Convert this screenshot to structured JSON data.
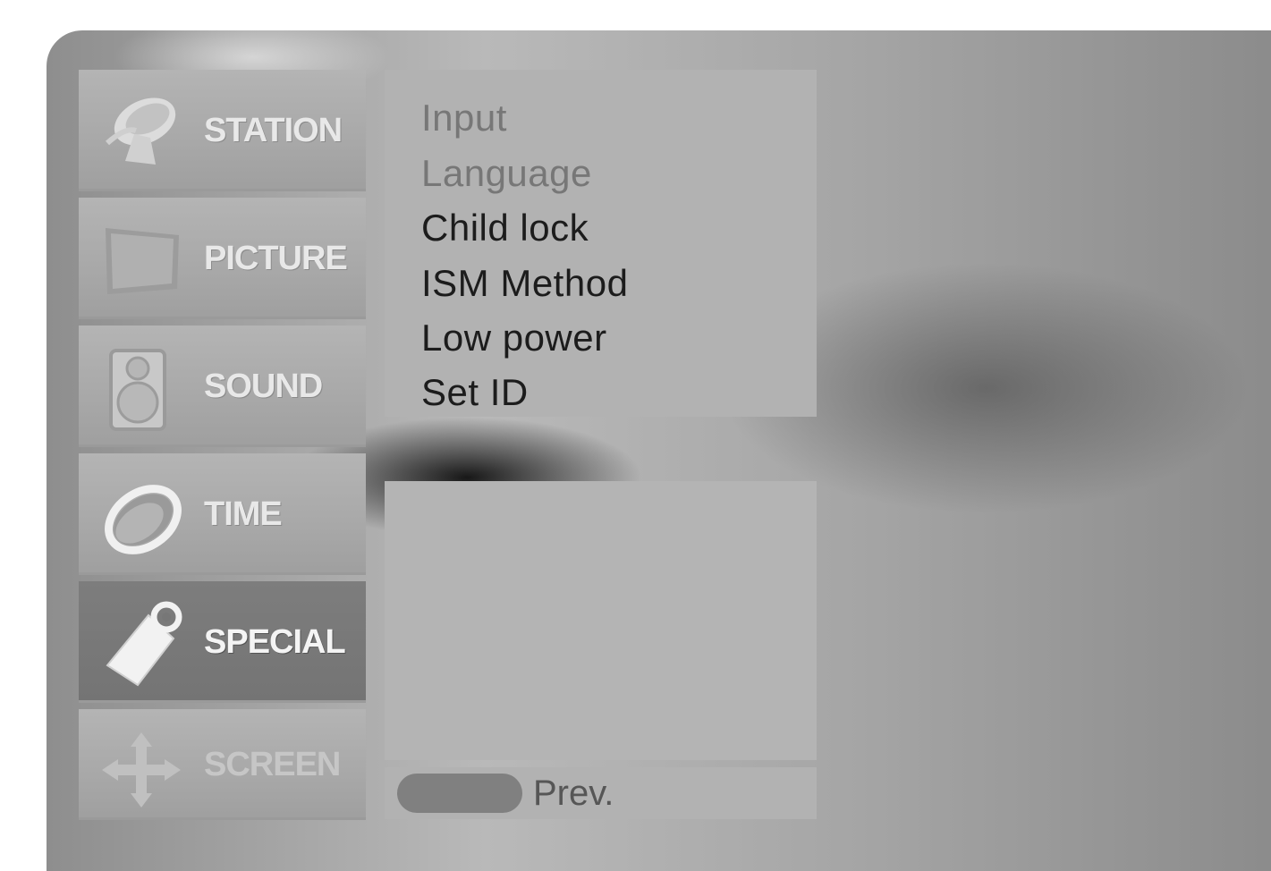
{
  "sidebar": {
    "items": [
      {
        "label": "STATION",
        "icon": "satellite-dish-icon",
        "state": "normal"
      },
      {
        "label": "PICTURE",
        "icon": "picture-screen-icon",
        "state": "normal"
      },
      {
        "label": "SOUND",
        "icon": "speaker-icon",
        "state": "normal"
      },
      {
        "label": "TIME",
        "icon": "clock-icon",
        "state": "normal"
      },
      {
        "label": "SPECIAL",
        "icon": "tag-icon",
        "state": "selected"
      },
      {
        "label": "SCREEN",
        "icon": "arrows-cross-icon",
        "state": "dimmed"
      }
    ]
  },
  "submenu": {
    "items": [
      {
        "label": "Input",
        "enabled": false
      },
      {
        "label": "Language",
        "enabled": false
      },
      {
        "label": "Child lock",
        "enabled": true
      },
      {
        "label": "ISM Method",
        "enabled": true
      },
      {
        "label": "Low power",
        "enabled": true
      },
      {
        "label": "Set ID",
        "enabled": true
      }
    ]
  },
  "footer": {
    "prev_label": "Prev."
  },
  "colors": {
    "panel": "#b2b2b2",
    "selected_item": "#7a7a7a",
    "text_enabled": "#1c1c1c",
    "text_disabled": "#777777"
  }
}
